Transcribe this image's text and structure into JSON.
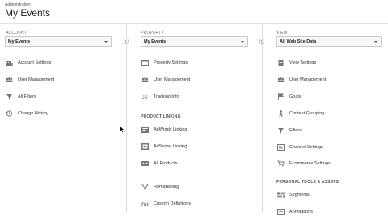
{
  "header": {
    "breadcrumb": "Administration",
    "title": "My Events"
  },
  "account": {
    "label": "ACCOUNT",
    "selected": "My Events",
    "items": [
      {
        "label": "Account Settings",
        "icon": "building-icon"
      },
      {
        "label": "User Management",
        "icon": "users-icon"
      },
      {
        "label": "All Filters",
        "icon": "filter-icon"
      },
      {
        "label": "Change History",
        "icon": "history-icon"
      }
    ]
  },
  "property": {
    "label": "PROPERTY",
    "selected": "My Events",
    "items": [
      {
        "label": "Property Settings",
        "icon": "window-icon"
      },
      {
        "label": "User Management",
        "icon": "users-icon"
      },
      {
        "label": "Tracking Info",
        "icon": "js-icon"
      }
    ],
    "section_linking": "PRODUCT LINKING",
    "linking_items": [
      {
        "label": "AdWords Linking",
        "icon": "adwords-icon"
      },
      {
        "label": "AdSense Linking",
        "icon": "adsense-icon"
      },
      {
        "label": "All Products",
        "icon": "products-icon"
      }
    ],
    "more_items": [
      {
        "label": "Remarketing",
        "icon": "remarketing-icon"
      },
      {
        "label": "Custom Definitions",
        "icon": "dd-icon"
      }
    ]
  },
  "view": {
    "label": "VIEW",
    "selected": "All Web Site Data",
    "items": [
      {
        "label": "View Settings",
        "icon": "document-icon"
      },
      {
        "label": "User Management",
        "icon": "users-icon"
      },
      {
        "label": "Goals",
        "icon": "flag-icon"
      },
      {
        "label": "Content Grouping",
        "icon": "person-icon"
      },
      {
        "label": "Filters",
        "icon": "filter-icon"
      },
      {
        "label": "Channel Settings",
        "icon": "channel-icon"
      },
      {
        "label": "Ecommerce Settings",
        "icon": "cart-icon"
      }
    ],
    "section_tools": "PERSONAL TOOLS & ASSETS",
    "tools_items": [
      {
        "label": "Segments",
        "icon": "segments-icon"
      },
      {
        "label": "Annotations",
        "icon": "annotations-icon"
      }
    ]
  }
}
